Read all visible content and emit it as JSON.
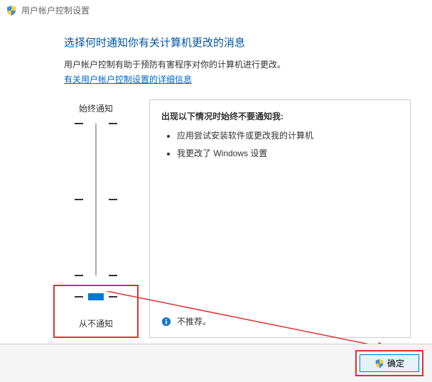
{
  "titlebar": {
    "title": "用户帐户控制设置"
  },
  "heading": "选择何时通知你有关计算机更改的消息",
  "subtext": "用户帐户控制有助于预防有害程序对你的计算机进行更改。",
  "link": "有关用户帐户控制设置的详细信息",
  "slider": {
    "top_label": "始终通知",
    "bottom_label": "从不通知"
  },
  "info": {
    "title": "出现以下情况时始终不要通知我:",
    "items": [
      "应用尝试安装软件或更改我的计算机",
      "我更改了 Windows 设置"
    ],
    "note": "不推荐。"
  },
  "footer": {
    "ok_label": "确定"
  }
}
